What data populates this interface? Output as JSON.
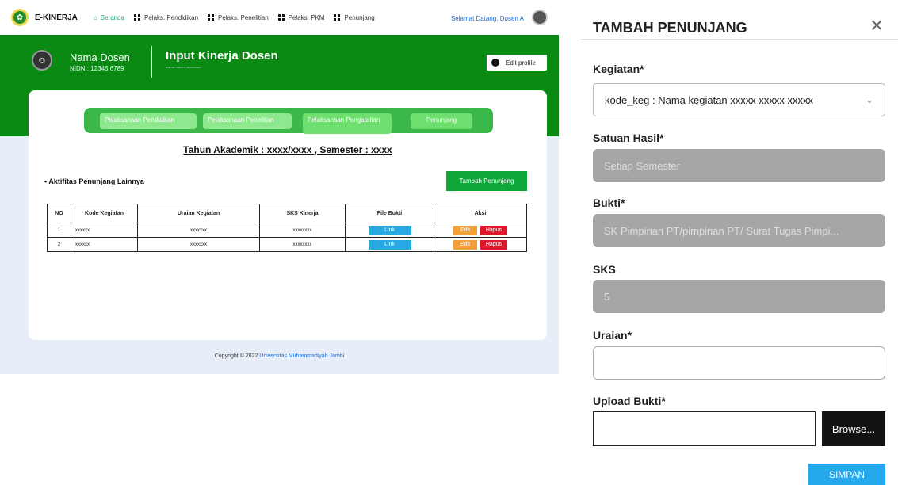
{
  "topnav": {
    "brand": "E-KINERJA",
    "items": [
      "Beranda",
      "Pelaks. Pendidikan",
      "Pelaks. Penelitian",
      "Pelaks. PKM",
      "Penunjang"
    ],
    "welcome": "Selamat Datang, Dosen A"
  },
  "hero": {
    "name": "Nama Dosen",
    "nidn": "NIDN : 12345 6789",
    "title": "Input Kinerja Dosen",
    "breadcrumb": "Halaman Utama >> Input Kinerja",
    "edit_profile": "Edit profile"
  },
  "tabs": [
    "Pelaksanaan Pendidikan",
    "Pelaksanaan Penelitian",
    "Pelaksanaan Pengabdian",
    "Penunjang"
  ],
  "tahun": "Tahun Akademik : xxxx/xxxx , Semester : xxxx",
  "section_title": "• Aktifitas Penunjang Lainnya",
  "add_button": "Tambah Penunjang",
  "table": {
    "headers": [
      "NO",
      "Kode Kegiatan",
      "Uraian Kegiatan",
      "SKS Kinerja",
      "File Bukti",
      "Aksi"
    ],
    "rows": [
      {
        "no": "1",
        "kode": "xxxxxx",
        "uraian": "xxxxxxx",
        "sks": "xxxxxxxx",
        "link": "Link",
        "edit": "Edit",
        "hapus": "Hapus"
      },
      {
        "no": "2",
        "kode": "xxxxxx",
        "uraian": "xxxxxxx",
        "sks": "xxxxxxxx",
        "link": "Link",
        "edit": "Edit",
        "hapus": "Hapus"
      }
    ]
  },
  "footer": {
    "prefix": "Copyright © 2022",
    "university": "Universitas Muhammadiyah Jambi"
  },
  "panel": {
    "title": "TAMBAH PENUNJANG",
    "close": "×",
    "kegiatan_label": "Kegiatan*",
    "kegiatan_value": "kode_keg : Nama kegiatan xxxxx xxxxx xxxxx",
    "satuan_label": "Satuan Hasil*",
    "satuan_value": "Setiap Semester",
    "bukti_label": "Bukti*",
    "bukti_value": "SK Pimpinan PT/pimpinan PT/ Surat Tugas Pimpi...",
    "sks_label": "SKS",
    "sks_value": "5",
    "uraian_label": "Uraian*",
    "upload_label": "Upload Bukti*",
    "browse": "Browse...",
    "simpan": "SIMPAN"
  },
  "colors": {
    "green": "#0a8a12",
    "tab_green": "#3cb84a",
    "button_blue": "#26a8ec",
    "danger": "#e0182d",
    "warning": "#f4a03a"
  }
}
